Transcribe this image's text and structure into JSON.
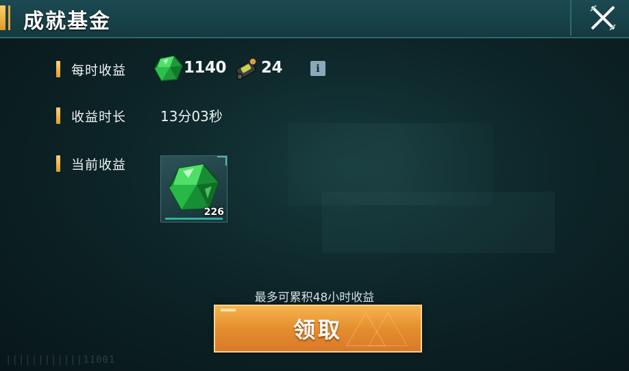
{
  "header": {
    "title": "成就基金"
  },
  "rows": {
    "hourly": {
      "label": "每时收益",
      "gem_value": "1140",
      "part_value": "24"
    },
    "duration": {
      "label": "收益时长",
      "value": "13分03秒"
    },
    "current": {
      "label": "当前收益",
      "item_qty": "226"
    }
  },
  "note": "最多可累积48小时收益",
  "claim_button": "领取",
  "info_glyph": "i",
  "footer_code": "||||||||||||11001",
  "colors": {
    "accent": "#e79b2b",
    "button": "#e48e2e",
    "panel": "#0d2528"
  },
  "icons": [
    "emerald-gem-icon",
    "mech-part-icon",
    "info-icon",
    "close-icon"
  ]
}
